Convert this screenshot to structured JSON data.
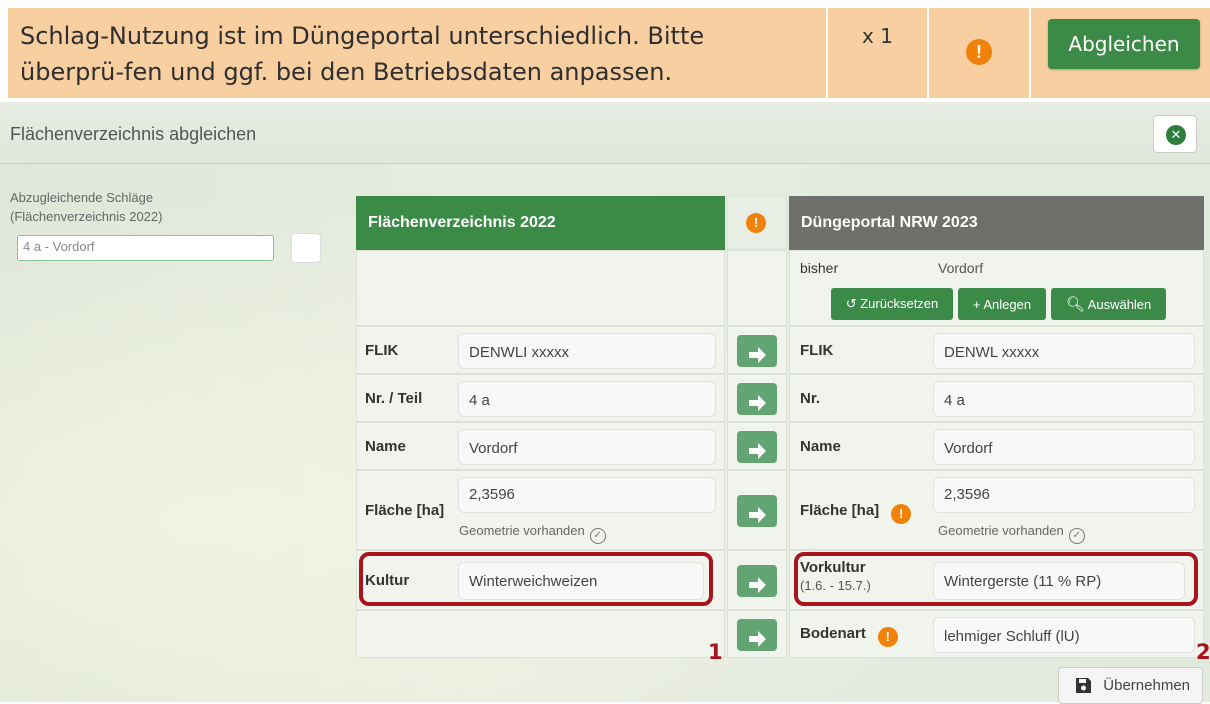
{
  "banner": {
    "message": "Schlag-Nutzung ist im Düngeportal unterschiedlich. Bitte überprü-fen und ggf. bei den Betriebsdaten anpassen.",
    "count": "x 1",
    "warn_icon": "exclamation-circle-icon",
    "button_label": "Abgleichen"
  },
  "modal": {
    "title": "Flächenverzeichnis abgleichen",
    "close_icon": "close-circle-icon",
    "left_label_line1": "Abzugleichende Schläge",
    "left_label_line2": "(Flächenverzeichnis 2022)",
    "left_select_value": "4 a - Vordorf",
    "left_header": "Flächenverzeichnis 2022",
    "right_header": "Düngeportal NRW 2023",
    "bisher_label": "bisher",
    "bisher_value": "Vordorf",
    "btn_reset": "Zurücksetzen",
    "btn_add": "Anlegen",
    "btn_select": "Auswählen",
    "save_label": "Übernehmen",
    "left_rows": {
      "flik_label": "FLIK",
      "flik_value": "DENWLI  xxxxx",
      "nr_label": "Nr. / Teil",
      "nr_value": "4 a",
      "name_label": "Name",
      "name_value": "Vordorf",
      "area_label": "Fläche [ha]",
      "area_value": "2,3596",
      "geo_text": "Geometrie vorhanden",
      "crop_label": "Kultur",
      "crop_value": "Winterweichweizen"
    },
    "right_rows": {
      "flik_label": "FLIK",
      "flik_value": "DENWL  xxxxx",
      "nr_label": "Nr.",
      "nr_value": "4 a",
      "name_label": "Name",
      "name_value": "Vordorf",
      "area_label": "Fläche [ha]",
      "area_value": "2,3596",
      "geo_text": "Geometrie vorhanden",
      "precrop_label": "Vorkultur",
      "precrop_sub": "(1.6. - 15.7.)",
      "precrop_value": "Wintergerste (11 % RP)",
      "soil_label": "Bodenart",
      "soil_value": "lehmiger Schluff (lU)"
    },
    "annotation_1": "1",
    "annotation_2": "2"
  },
  "colors": {
    "banner_bg": "#f8cfa0",
    "brand_green": "#3c8a47",
    "header_green": "#3b8b47",
    "header_gray": "#6f706c",
    "warning_orange": "#f0820a",
    "highlight_red": "#a8141c"
  }
}
